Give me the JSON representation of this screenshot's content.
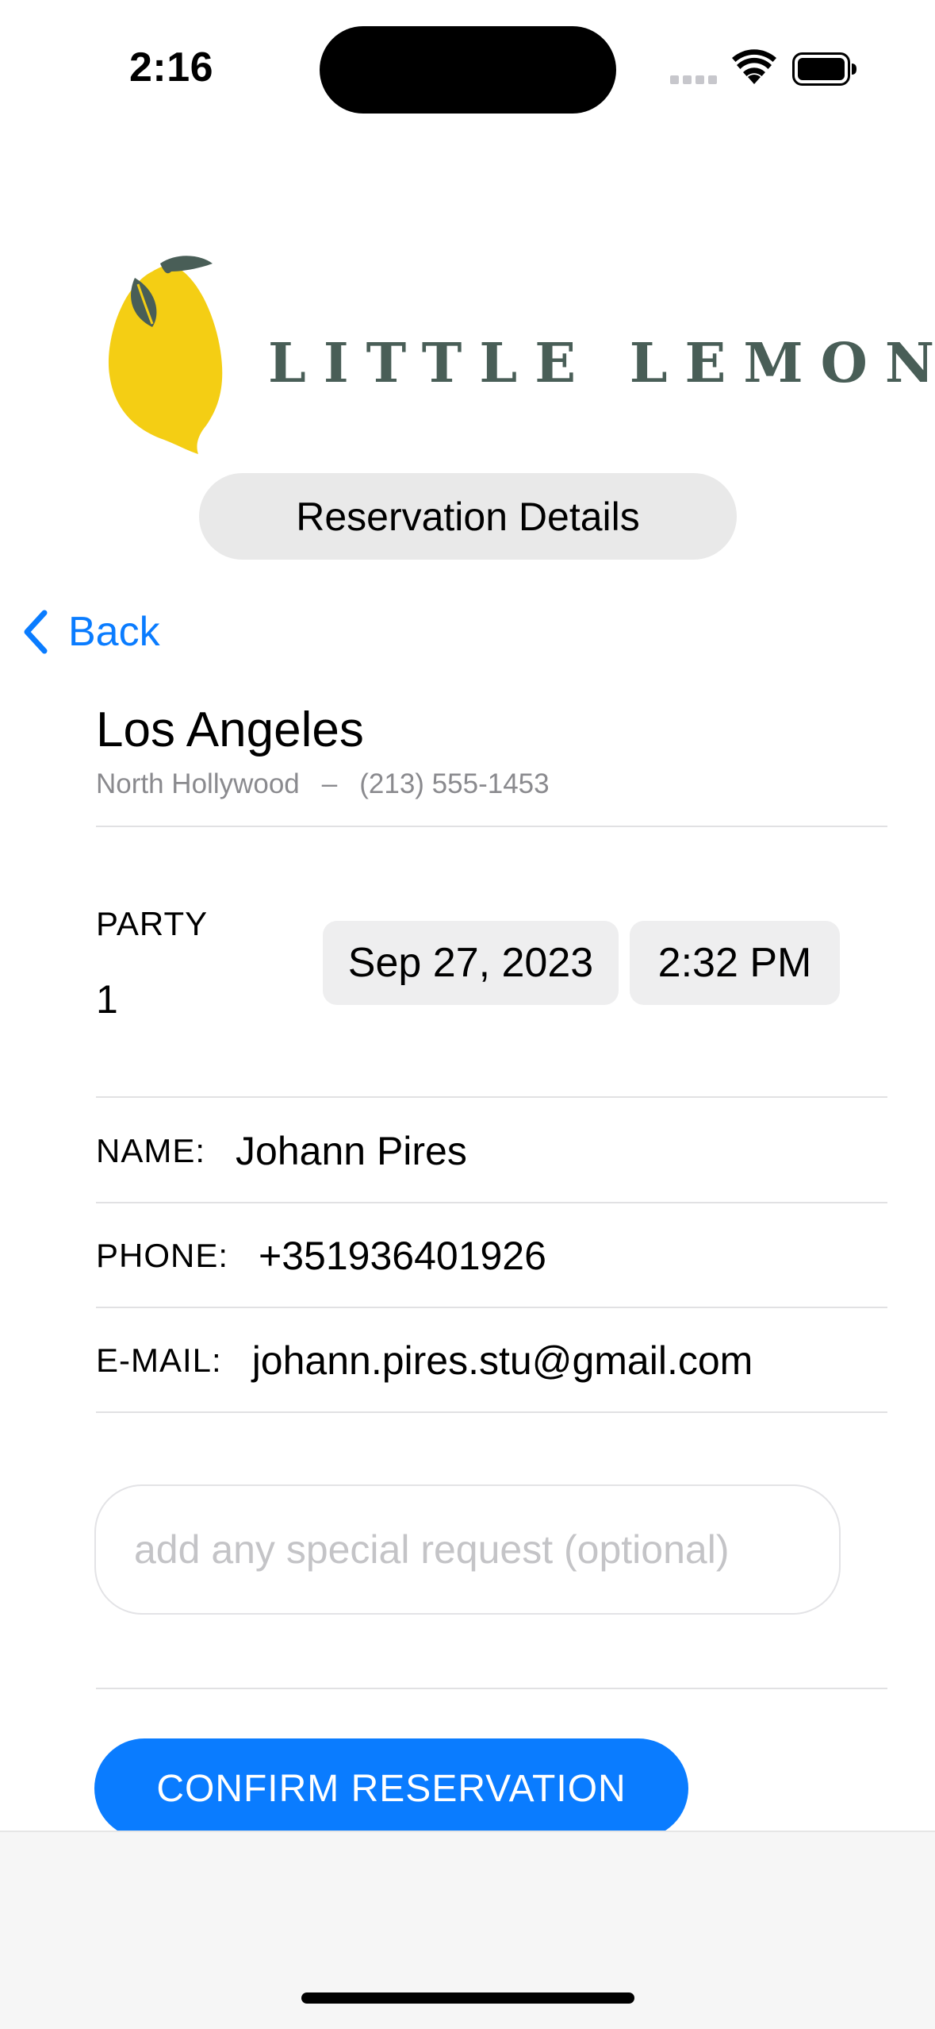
{
  "status_bar": {
    "time": "2:16"
  },
  "brand": {
    "name": "LITTLE LEMON",
    "color": "#495E57",
    "lemon_color": "#F4CE14"
  },
  "header": {
    "title": "Reservation Details"
  },
  "nav": {
    "back_label": "Back",
    "accent_color": "#0A7CFF"
  },
  "location": {
    "city": "Los Angeles",
    "neighborhood": "North Hollywood",
    "separator": "–",
    "phone": "(213) 555-1453"
  },
  "party": {
    "label": "PARTY",
    "value": "1"
  },
  "date_picker": {
    "date": "Sep 27, 2023",
    "time": "2:32 PM"
  },
  "fields": {
    "name": {
      "label": "NAME:",
      "value": "Johann Pires"
    },
    "phone": {
      "label": "PHONE:",
      "value": "+351936401926"
    },
    "email": {
      "label": "E-MAIL:",
      "value": "johann.pires.stu@gmail.com"
    }
  },
  "special_request": {
    "placeholder": "add any special request (optional)"
  },
  "actions": {
    "confirm_label": "CONFIRM RESERVATION"
  },
  "icons": [
    "wifi-icon",
    "battery-icon",
    "lemon-icon",
    "chevron-left-icon"
  ]
}
